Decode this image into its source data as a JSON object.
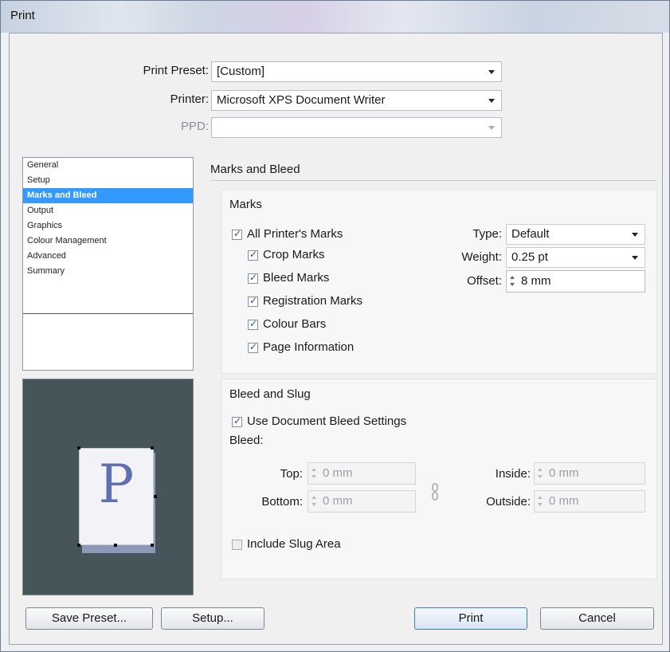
{
  "window": {
    "title": "Print"
  },
  "header": {
    "preset_label": "Print Preset:",
    "preset_value": "[Custom]",
    "printer_label": "Printer:",
    "printer_value": "Microsoft XPS Document Writer",
    "ppd_label": "PPD:",
    "ppd_value": ""
  },
  "sidebar": {
    "items": [
      {
        "label": "General"
      },
      {
        "label": "Setup"
      },
      {
        "label": "Marks and Bleed"
      },
      {
        "label": "Output"
      },
      {
        "label": "Graphics"
      },
      {
        "label": "Colour Management"
      },
      {
        "label": "Advanced"
      },
      {
        "label": "Summary"
      }
    ],
    "selected": "Marks and Bleed"
  },
  "preview": {
    "letter": "P"
  },
  "panel": {
    "title": "Marks and Bleed",
    "marks": {
      "title": "Marks",
      "all_printers_marks": {
        "label": "All Printer's Marks",
        "checked": true
      },
      "crop_marks": {
        "label": "Crop Marks",
        "checked": true
      },
      "bleed_marks": {
        "label": "Bleed Marks",
        "checked": true
      },
      "registration_marks": {
        "label": "Registration Marks",
        "checked": true
      },
      "colour_bars": {
        "label": "Colour Bars",
        "checked": true
      },
      "page_information": {
        "label": "Page Information",
        "checked": true
      },
      "type_label": "Type:",
      "type_value": "Default",
      "weight_label": "Weight:",
      "weight_value": "0.25 pt",
      "offset_label": "Offset:",
      "offset_value": "8 mm"
    },
    "bleed_slug": {
      "title": "Bleed and Slug",
      "use_document_bleed": {
        "label": "Use Document Bleed Settings",
        "checked": true
      },
      "bleed_label": "Bleed:",
      "top_label": "Top:",
      "top_value": "0 mm",
      "bottom_label": "Bottom:",
      "bottom_value": "0 mm",
      "inside_label": "Inside:",
      "inside_value": "0 mm",
      "outside_label": "Outside:",
      "outside_value": "0 mm",
      "include_slug": {
        "label": "Include Slug Area",
        "checked": false
      }
    }
  },
  "footer": {
    "save_preset": "Save Preset...",
    "setup": "Setup...",
    "print": "Print",
    "cancel": "Cancel"
  },
  "colors": {
    "selection": "#3399ff",
    "preview_bg": "#46555a",
    "preview_letter": "#5f6fb0"
  }
}
